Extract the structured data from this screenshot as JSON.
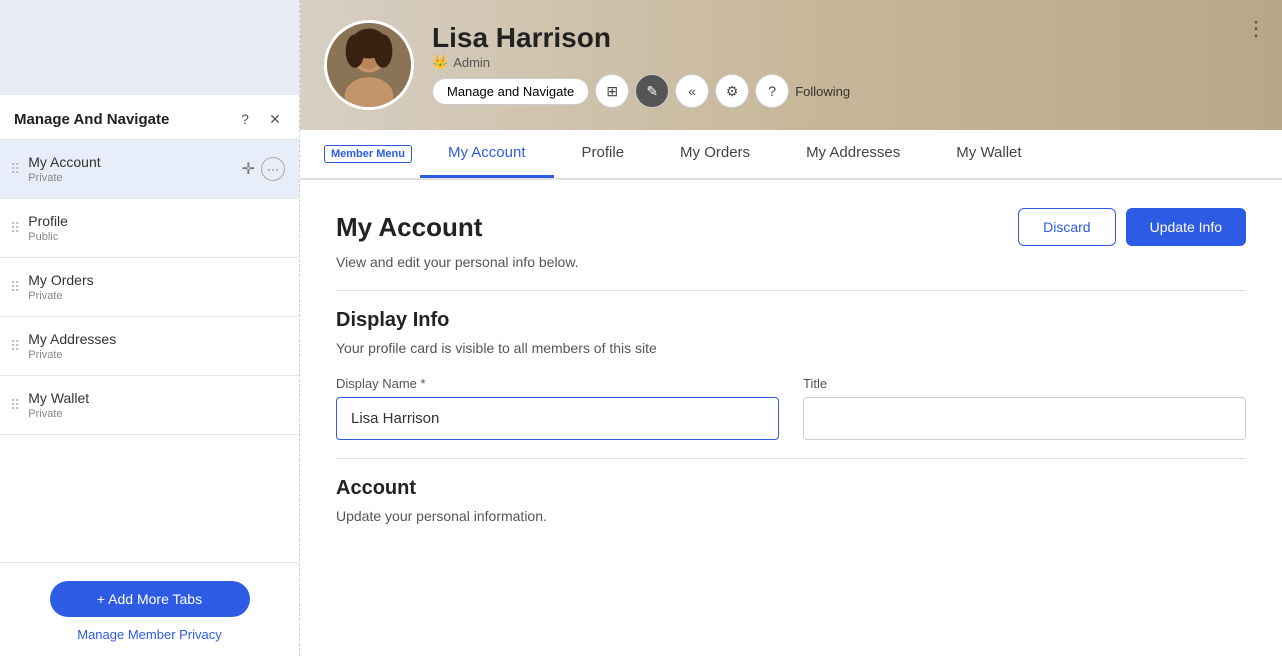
{
  "sidebar": {
    "header": {
      "title": "Manage And Navigate",
      "help_icon": "?",
      "close_icon": "✕"
    },
    "items": [
      {
        "label": "My Account",
        "sublabel": "Private",
        "active": true
      },
      {
        "label": "Profile",
        "sublabel": "Public",
        "active": false
      },
      {
        "label": "My Orders",
        "sublabel": "Private",
        "active": false
      },
      {
        "label": "My Addresses",
        "sublabel": "Private",
        "active": false
      },
      {
        "label": "My Wallet",
        "sublabel": "Private",
        "active": false
      }
    ],
    "footer": {
      "add_tabs_label": "+ Add More Tabs",
      "manage_privacy_label": "Manage Member Privacy"
    }
  },
  "banner": {
    "user_name": "Lisa Harrison",
    "user_role": "Admin",
    "toolbar_manage": "Manage and Navigate",
    "toolbar_following": "ollowing"
  },
  "member_menu": {
    "label": "Member Menu",
    "tabs": [
      {
        "label": "My Account",
        "active": true
      },
      {
        "label": "Profile",
        "active": false
      },
      {
        "label": "My Orders",
        "active": false
      },
      {
        "label": "My Addresses",
        "active": false
      },
      {
        "label": "My Wallet",
        "active": false
      }
    ]
  },
  "content": {
    "page_title": "My Account",
    "page_subtitle": "View and edit your personal info below.",
    "discard_label": "Discard",
    "update_label": "Update Info",
    "display_info_title": "Display Info",
    "display_info_subtitle": "Your profile card is visible to all members of this site",
    "fields": {
      "display_name_label": "Display Name *",
      "display_name_value": "Lisa Harrison",
      "display_name_placeholder": "",
      "title_label": "Title",
      "title_value": "",
      "title_placeholder": ""
    },
    "account_title": "Account",
    "account_subtitle": "Update your personal information."
  }
}
